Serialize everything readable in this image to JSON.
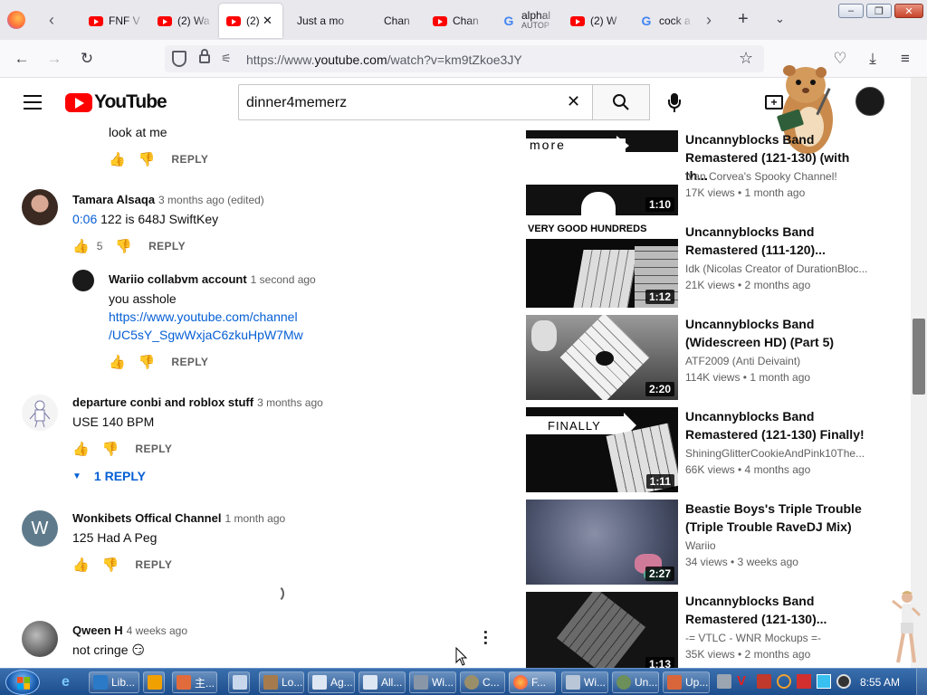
{
  "browser": {
    "tabs": [
      {
        "title": "FNF V",
        "icon": "youtube-favicon"
      },
      {
        "title": "(2) Wa",
        "icon": "youtube-favicon"
      },
      {
        "title": "(2)",
        "icon": "youtube-favicon",
        "active": true
      },
      {
        "title": "Just a mo",
        "icon": "none"
      },
      {
        "title": "Chan",
        "icon": "none"
      },
      {
        "title": "Chan",
        "icon": "youtube-favicon"
      },
      {
        "title": "alphal",
        "subtitle": "AUTOP",
        "icon": "google-favicon"
      },
      {
        "title": "(2) W",
        "icon": "youtube-favicon"
      },
      {
        "title": "cock a",
        "icon": "google-favicon"
      }
    ],
    "url_prefix": "https://www.",
    "url_domain": "youtube.com",
    "url_path": "/watch?v=km9tZkoe3JY"
  },
  "youtube": {
    "logo_text": "YouTube",
    "search_value": "dinner4memerz"
  },
  "comments": {
    "top_reply_text": "look at me",
    "reply_label": "REPLY",
    "items": [
      {
        "author": "Tamara Alsaqa",
        "ago": "3 months ago (edited)",
        "timestamp_link": "0:06",
        "text": "122 is 648J SwiftKey",
        "likes": "5"
      },
      {
        "author": "Wariio collabvm account",
        "ago": "1 second ago",
        "text": "you asshole",
        "link_line1": "https://www.youtube.com/channel",
        "link_line2": "/UC5sY_SgwWxjaC6zkuHpW7Mw"
      },
      {
        "author": "departure conbi and roblox stuff",
        "ago": "3 months ago",
        "text": "USE 140 BPM",
        "replies_label": "1 REPLY"
      },
      {
        "author": "Wonkibets Offical Channel",
        "ago": "1 month ago",
        "text": "125 Had A Peg",
        "avatar_letter": "W"
      },
      {
        "author": "Qween H",
        "ago": "4 weeks ago",
        "text": "not cringe 😏"
      }
    ]
  },
  "recommended": [
    {
      "title": "Uncannyblocks Band Remastered (121-130) (with th...",
      "channel": "Ivan Corvea's Spooky Channel!",
      "meta": "17K views • 1 month ago",
      "duration": "1:10",
      "thumb_label": "more"
    },
    {
      "title": "Uncannyblocks Band Remastered (111-120)...",
      "channel": "Idk (Nicolas Creator of DurationBloc...",
      "meta": "21K views • 2 months ago",
      "duration": "1:12",
      "thumb_label": "VERY GOOD HUNDREDS"
    },
    {
      "title": "Uncannyblocks Band (Widescreen HD) (Part 5)",
      "channel": "ATF2009 (Anti Deivaint)",
      "meta": "114K views • 1 month ago",
      "duration": "2:20",
      "thumb_label": ""
    },
    {
      "title": "Uncannyblocks Band Remastered (121-130) Finally!",
      "channel": "ShiningGlitterCookieAndPink10The...",
      "meta": "66K views • 4 months ago",
      "duration": "1:11",
      "thumb_label": "FINALLY"
    },
    {
      "title": "Beastie Boys's Triple Trouble (Triple Trouble RaveDJ Mix)",
      "channel": "Wariio",
      "meta": "34 views • 3 weeks ago",
      "duration": "2:27",
      "thumb_label": ""
    },
    {
      "title": "Uncannyblocks Band Remastered (121-130)...",
      "channel": "-= VTLC - WNR Mockups =-",
      "meta": "35K views • 2 months ago",
      "duration": "1:13",
      "thumb_label": ""
    }
  ],
  "taskbar": {
    "items": [
      "Lib...",
      "",
      "主...",
      "",
      "Lo...",
      "Ag...",
      "All...",
      "Wi...",
      "C...",
      "F...",
      "Wi...",
      "Un...",
      "Up..."
    ],
    "clock": "8:55 AM"
  },
  "colors": {
    "youtube_red": "#ff0000",
    "link_blue": "#065fd4",
    "taskbar_blue": "#245a9c"
  }
}
